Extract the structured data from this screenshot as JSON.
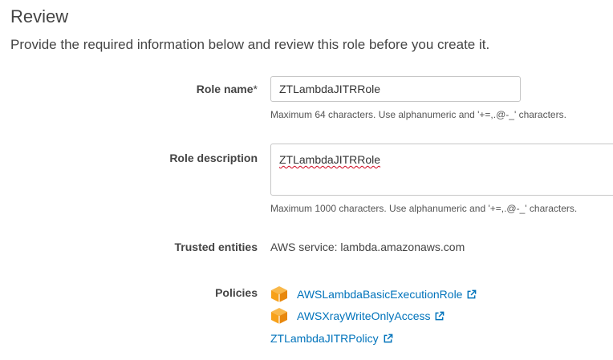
{
  "page": {
    "title": "Review",
    "subtitle": "Provide the required information below and review this role before you create it."
  },
  "role_name": {
    "label": "Role name",
    "required_mark": "*",
    "value": "ZTLambdaJITRRole",
    "hint": "Maximum 64 characters. Use alphanumeric and '+=,.@-_' characters."
  },
  "role_description": {
    "label": "Role description",
    "value": "ZTLambdaJITRRole",
    "hint": "Maximum 1000 characters. Use alphanumeric and '+=,.@-_' characters."
  },
  "trusted_entities": {
    "label": "Trusted entities",
    "value": "AWS service: lambda.amazonaws.com"
  },
  "policies": {
    "label": "Policies",
    "items": [
      {
        "name": "AWSLambdaBasicExecutionRole",
        "icon": "aws-managed-policy-icon"
      },
      {
        "name": "AWSXrayWriteOnlyAccess",
        "icon": "aws-managed-policy-icon"
      },
      {
        "name": "ZTLambdaJITRPolicy",
        "icon": ""
      }
    ]
  },
  "colors": {
    "link": "#0073bb",
    "aws_icon": "#f7a11a",
    "spellcheck": "#d0021b"
  }
}
